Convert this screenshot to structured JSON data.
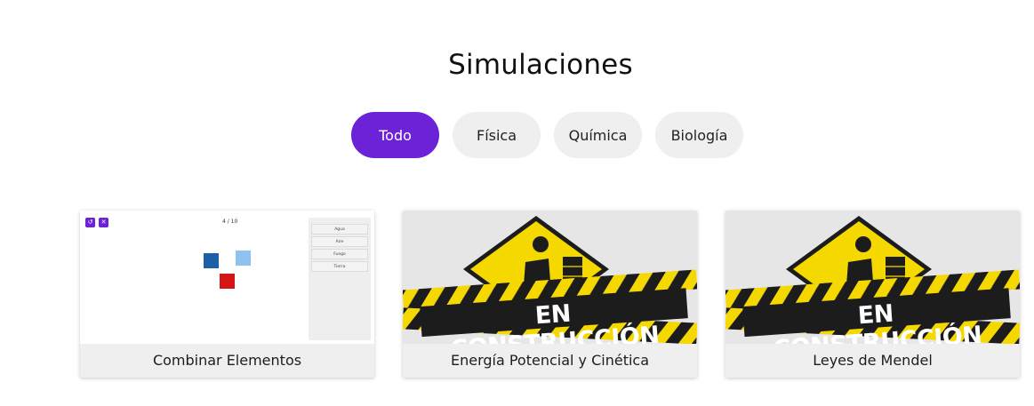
{
  "page": {
    "title": "Simulaciones"
  },
  "filters": [
    {
      "label": "Todo",
      "active": true
    },
    {
      "label": "Física",
      "active": false
    },
    {
      "label": "Química",
      "active": false
    },
    {
      "label": "Biología",
      "active": false
    }
  ],
  "cards": [
    {
      "title": "Combinar Elementos",
      "preview": {
        "counter": "4 / 10",
        "panel_items": [
          "Agua",
          "Aire",
          "Fuego",
          "Tierra"
        ]
      }
    },
    {
      "title": "Energía Potencial y Cinética",
      "banner": "EN CONSTRUCCIÓN"
    },
    {
      "title": "Leyes de Mendel",
      "banner": "EN CONSTRUCCIÓN"
    }
  ],
  "colors": {
    "accent": "#6c22d6",
    "pill_bg": "#efefef",
    "card_bg": "#efefef",
    "warning_yellow": "#f5d800",
    "stripe_black": "#1c1c1c"
  }
}
